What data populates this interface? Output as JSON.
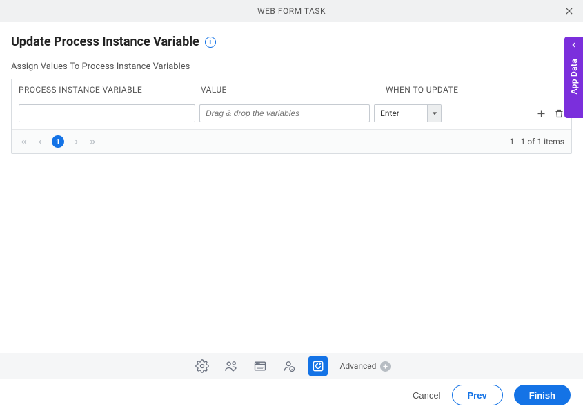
{
  "header": {
    "title": "WEB FORM TASK"
  },
  "page": {
    "title": "Update Process Instance Variable",
    "subhead": "Assign Values To Process Instance Variables"
  },
  "table": {
    "columns": {
      "c1": "PROCESS INSTANCE VARIABLE",
      "c2": "VALUE",
      "c3": "WHEN TO UPDATE"
    },
    "row": {
      "variable_value": "",
      "value_placeholder": "Drag & drop the variables",
      "when_selected": "Enter"
    }
  },
  "pager": {
    "current": "1",
    "info": "1 - 1 of 1 items"
  },
  "side_tab": {
    "label": "App Data"
  },
  "toolbar": {
    "advanced_label": "Advanced"
  },
  "footer": {
    "cancel": "Cancel",
    "prev": "Prev",
    "finish": "Finish"
  }
}
